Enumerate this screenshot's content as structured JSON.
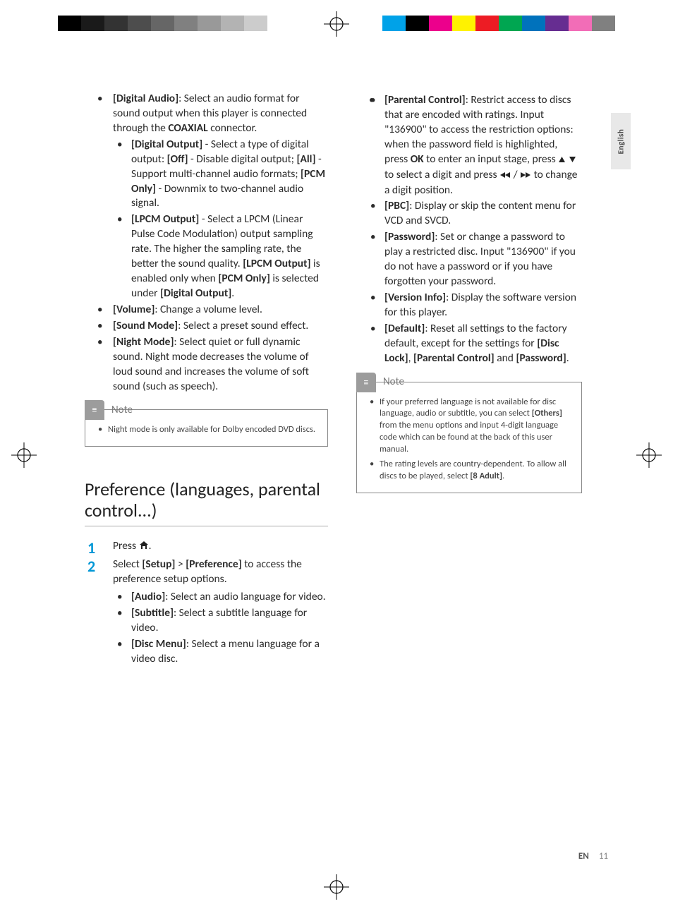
{
  "colorbars": {
    "left": [
      "#000000",
      "#1a1a1a",
      "#333333",
      "#4d4d4d",
      "#666666",
      "#808080",
      "#999999",
      "#b3b3b3",
      "#cccccc",
      "#ffffff"
    ],
    "right": [
      "#00a2e8",
      "#000000",
      "#ec008c",
      "#fff200",
      "#ed1c24",
      "#00a651",
      "#0072bc",
      "#662d91",
      "#f26db7",
      "#808080"
    ]
  },
  "side_tab": "English",
  "footer": {
    "lang": "EN",
    "page": "11"
  },
  "left": {
    "digital_audio": {
      "label": "[Digital Audio]",
      "text": ": Select an audio format for sound output when this player is connected through the ",
      "bold_tail": "COAXIAL",
      "text_after": " connector."
    },
    "digital_output": {
      "label": "[Digital Output]",
      "text": " - Select a type of digital output: ",
      "parts": [
        {
          "b": "[Off]",
          "t": " - Disable digital output; "
        },
        {
          "b": "[All]",
          "t": " - Support multi-channel audio formats; "
        },
        {
          "b": "[PCM Only]",
          "t": " - Downmix to two-channel audio signal."
        }
      ]
    },
    "lpcm": {
      "label": "[LPCM Output]",
      "text": " - Select a LPCM (Linear Pulse Code Modulation) output sampling rate. The higher the sampling rate, the better the sound quality. ",
      "b2": "[LPCM Output]",
      "t2": " is enabled only when ",
      "b3": "[PCM Only]",
      "t3": " is selected under ",
      "b4": "[Digital Output]",
      "t4": "."
    },
    "volume": {
      "label": "[Volume]",
      "text": ": Change a volume level."
    },
    "soundmode": {
      "label": "[Sound Mode]",
      "text": ": Select a preset sound effect."
    },
    "nightmode": {
      "label": "[Night Mode]",
      "text": ": Select quiet or full dynamic sound. Night mode decreases the volume of loud sound and increases the volume of soft sound (such as speech)."
    },
    "note": {
      "title": "Note",
      "items": [
        "Night mode is only available for Dolby encoded DVD discs."
      ]
    },
    "section_title": "Preference (languages, parental control...)",
    "steps": {
      "s1_pre": "Press ",
      "s1_post": ".",
      "s2_pre": "Select ",
      "s2_b1": "[Setup]",
      "s2_mid": " > ",
      "s2_b2": "[Preference]",
      "s2_post": " to access the preference setup options."
    },
    "audio": {
      "label": "[Audio]",
      "text": ": Select an audio language for video."
    },
    "subtitle": {
      "label": "[Subtitle]",
      "text": ": Select a subtitle language for video."
    },
    "discmenu": {
      "label": "[Disc Menu]",
      "text": ": Select a menu language for a video disc."
    }
  },
  "right": {
    "parental": {
      "label": "[Parental Control]",
      "t1": ": Restrict access to discs that are encoded with ratings. Input \"136900\" to access the restriction options: when the password field is highlighted, press ",
      "bOK": "OK",
      "t2": " to enter an input stage, press ",
      "t3": " to select a digit and press ",
      "t4": " to change a digit position."
    },
    "pbc": {
      "label": "[PBC]",
      "text": ": Display or skip the content menu for VCD and SVCD."
    },
    "password": {
      "label": "[Password]",
      "text": ": Set or change a password to play a restricted disc. Input \"136900\" if you do not have a password or if you have forgotten your password."
    },
    "version": {
      "label": "[Version Info]",
      "text": ": Display the software version for this player."
    },
    "default": {
      "label": "[Default]",
      "t1": ": Reset all settings to the factory default, except for the settings for ",
      "b1": "[Disc Lock]",
      "m1": ", ",
      "b2": "[Parental Control]",
      "m2": " and ",
      "b3": "[Password]",
      "t2": "."
    },
    "note": {
      "title": "Note",
      "items": [
        {
          "t1": "If your preferred language is not available for disc language, audio or subtitle, you can select ",
          "b": "[Others]",
          "t2": " from the menu options and input 4-digit language code which can be found at the back of this user manual."
        },
        {
          "t1": "The rating levels are country-dependent. To allow all discs to be played, select ",
          "b": "[8 Adult]",
          "t2": "."
        }
      ]
    }
  }
}
